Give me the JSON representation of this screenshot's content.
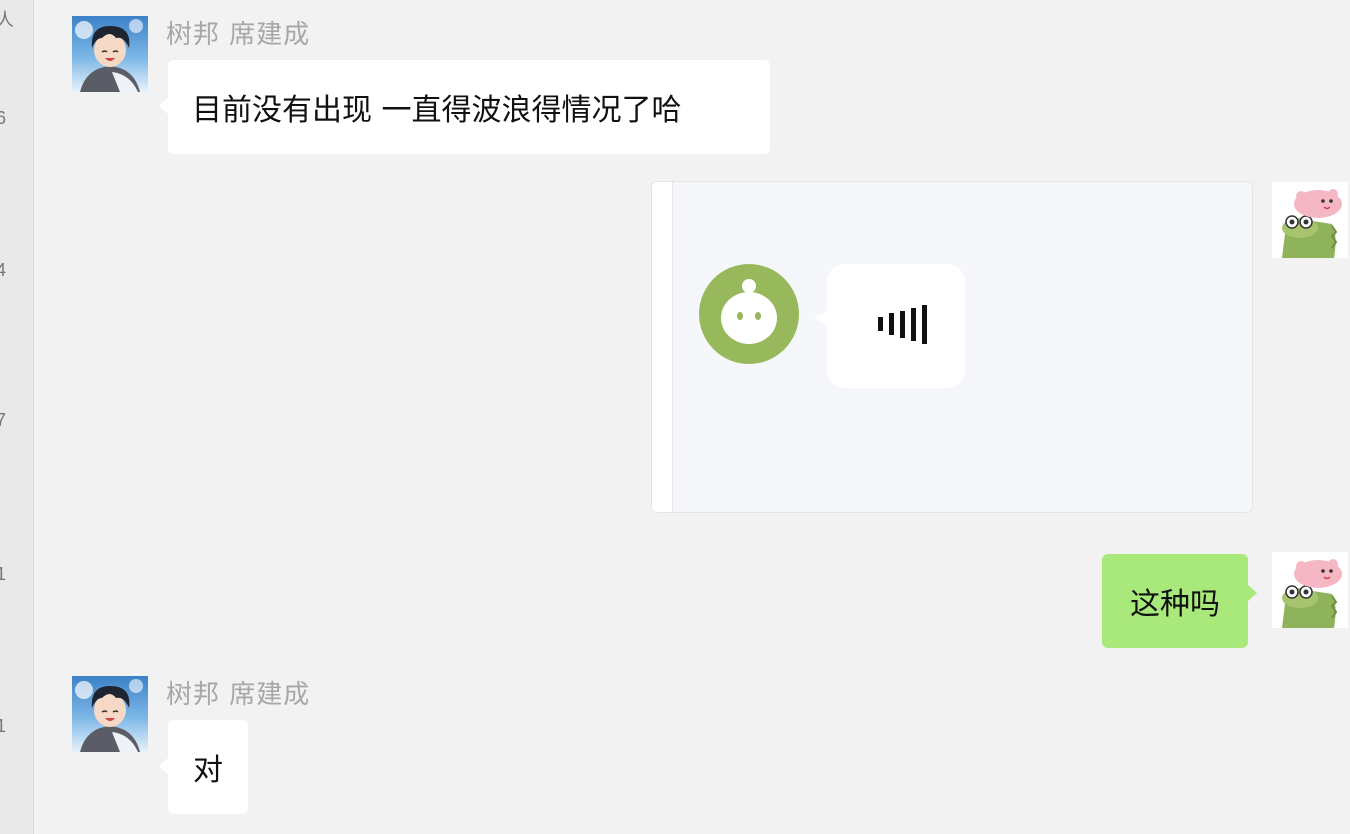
{
  "sidebar": {
    "chars": [
      "人",
      "6",
      "4",
      "7",
      "1",
      "1"
    ]
  },
  "messages": [
    {
      "sender": "树邦 席建成",
      "text": "目前没有出现  一直得波浪得情况了哈"
    },
    {
      "text": "这种吗"
    },
    {
      "sender": "树邦 席建成",
      "text": "对"
    }
  ],
  "card": {
    "icon": "voice-wave-icon"
  },
  "colors": {
    "background": "#f2f2f2",
    "incoming_bubble": "#ffffff",
    "outgoing_bubble": "#a9e97c",
    "bot_avatar": "#97b95b",
    "sender_name": "#a7a7a7"
  }
}
